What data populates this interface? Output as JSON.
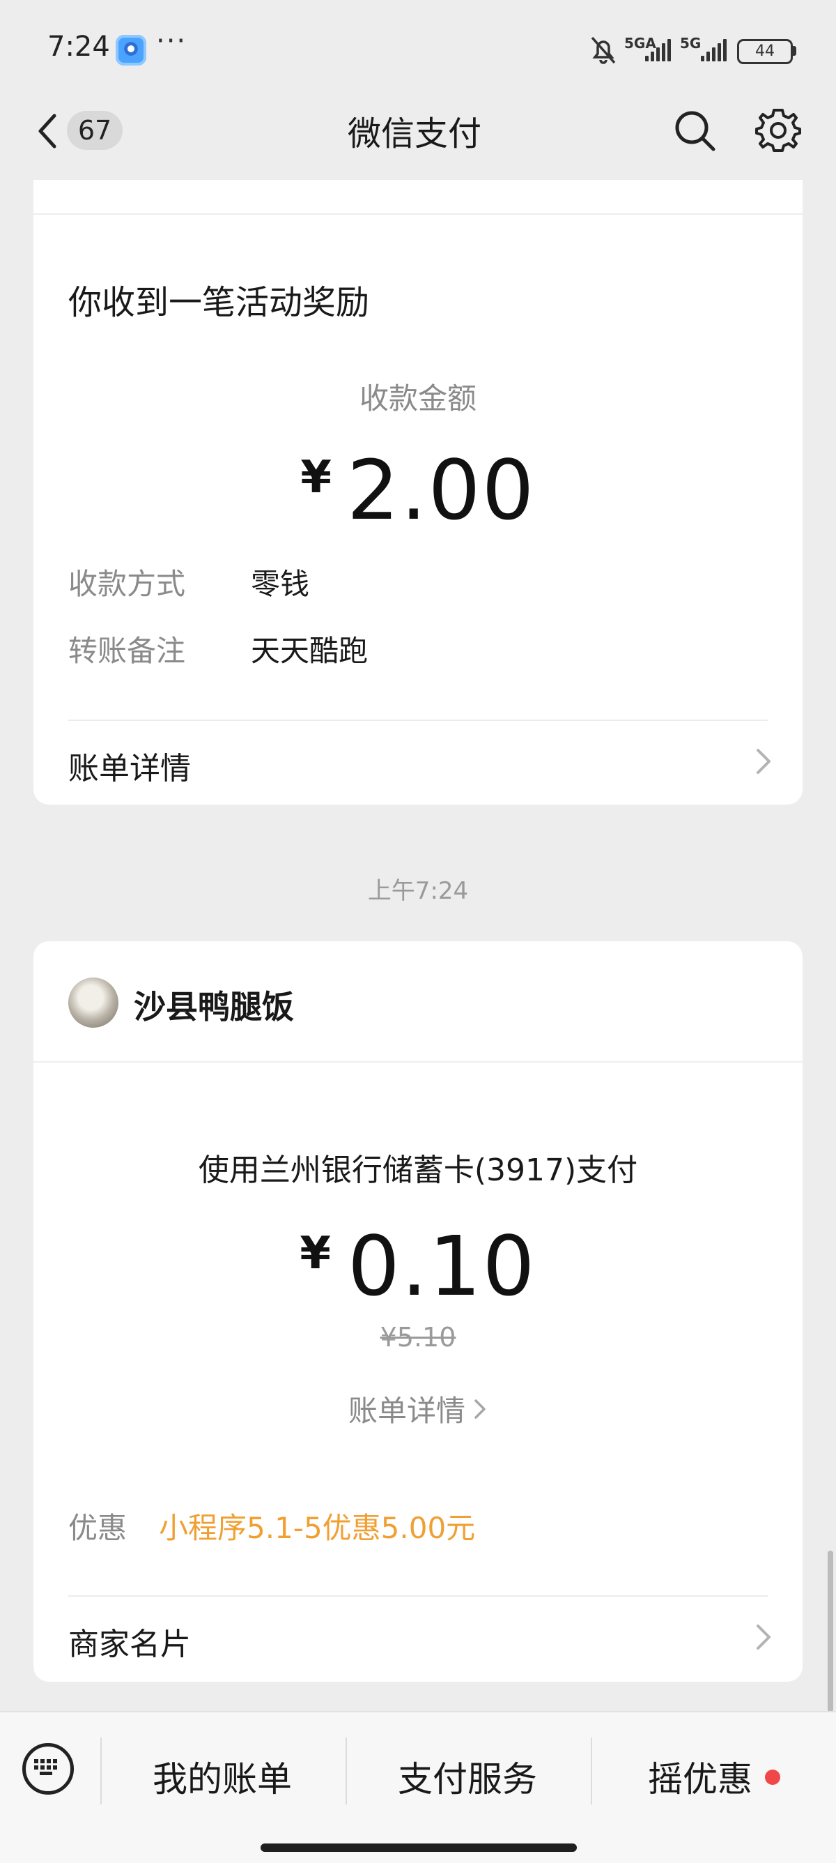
{
  "status_bar": {
    "time": "7:24",
    "overflow": "···",
    "network_1": "5GA",
    "network_2": "5G",
    "battery": "44"
  },
  "nav": {
    "back_count": "67",
    "title": "微信支付"
  },
  "reward_card": {
    "title": "你收到一笔活动奖励",
    "amount_label": "收款金额",
    "currency": "¥",
    "amount": "2.00",
    "pay_method_label": "收款方式",
    "pay_method_value": "零钱",
    "note_label": "转账备注",
    "note_value": "天天酷跑",
    "bill_detail": "账单详情"
  },
  "timestamp": "上午7:24",
  "payment_card": {
    "merchant_name": "沙县鸭腿饭",
    "pay_source": "使用兰州银行储蓄卡(3917)支付",
    "currency": "¥",
    "amount": "0.10",
    "original_price": "¥5.10",
    "bill_detail": "账单详情",
    "discount_label": "优惠",
    "discount_value": "小程序5.1-5优惠5.00元",
    "merchant_card": "商家名片"
  },
  "bottom_bar": {
    "item_1": "我的账单",
    "item_2": "支付服务",
    "item_3": "摇优惠"
  },
  "colors": {
    "background": "#ededed",
    "discount": "#f0a033",
    "badge_dot": "#f04848"
  },
  "icons": [
    "back-arrow-icon",
    "search-icon",
    "gear-icon",
    "chevron-right-icon",
    "keyboard-icon",
    "bell-muted-icon"
  ]
}
